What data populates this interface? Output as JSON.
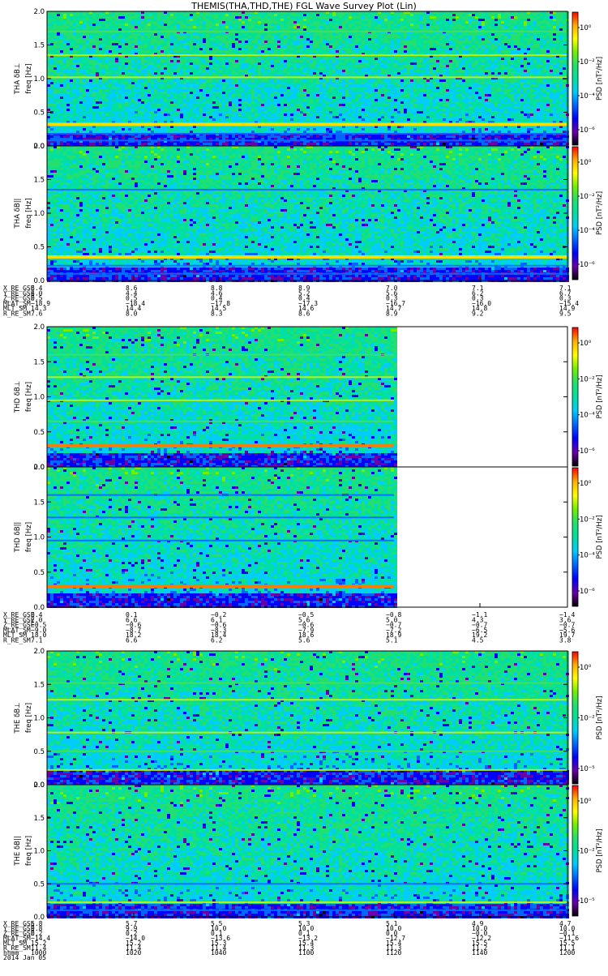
{
  "title": "THEMIS(THA,THD,THE) FGL Wave Survey Plot (Lin)",
  "colors": {
    "colorbar": [
      "#000000",
      "#6a00a8",
      "#0000ff",
      "#0066ff",
      "#00ccff",
      "#00e0a0",
      "#22e070",
      "#70f000",
      "#ffff00",
      "#ffb000",
      "#ff0000"
    ],
    "spectrogram_bg": "#2aa6e6"
  },
  "chart_data": [
    {
      "type": "heatmap",
      "label": "THA δB⊥",
      "ylabel": "freq [Hz]",
      "ylim": [
        0.0,
        2.0
      ],
      "yticks": [
        "0.0",
        "0.5",
        "1.0",
        "1.5",
        "2.0"
      ],
      "colorbar_label": "PSD [nT²/Hz]",
      "colorbar_ticks": [
        "10⁰",
        "10⁻²",
        "10⁻⁴",
        "10⁻⁶"
      ],
      "data_coverage_fraction": 1.0,
      "bands_hz": [
        0.08,
        0.18,
        0.32,
        1.02,
        1.35,
        1.7
      ],
      "band_strength": [
        0.3,
        0.2,
        1.0,
        0.7,
        0.8,
        0.4
      ]
    },
    {
      "type": "heatmap",
      "label": "THA δB||",
      "ylabel": "freq [Hz]",
      "ylim": [
        0.0,
        2.0
      ],
      "yticks": [
        "0.0",
        "0.5",
        "1.0",
        "1.5",
        "2.0"
      ],
      "colorbar_label": "PSD [nT²/Hz]",
      "colorbar_ticks": [
        "10⁰",
        "10⁻²",
        "10⁻⁴",
        "10⁻⁶"
      ],
      "data_coverage_fraction": 1.0,
      "bands_hz": [
        0.1,
        0.22,
        0.35,
        1.35
      ],
      "band_strength": [
        0.3,
        0.3,
        1.0,
        0.2
      ]
    },
    {
      "type": "heatmap",
      "label": "THD δB⊥",
      "ylabel": "freq [Hz]",
      "ylim": [
        0.0,
        2.0
      ],
      "yticks": [
        "0.0",
        "0.5",
        "1.0",
        "1.5",
        "2.0"
      ],
      "colorbar_label": "PSD [nT²/Hz]",
      "colorbar_ticks": [
        "10⁰",
        "10⁻²",
        "10⁻⁴",
        "10⁻⁶"
      ],
      "data_coverage_fraction": 0.6667,
      "bands_hz": [
        0.3,
        0.65,
        0.95,
        1.28,
        1.6
      ],
      "band_strength": [
        1.2,
        0.4,
        0.7,
        0.7,
        0.4
      ]
    },
    {
      "type": "heatmap",
      "label": "THD δB||",
      "ylabel": "freq [Hz]",
      "ylim": [
        0.0,
        2.0
      ],
      "yticks": [
        "0.0",
        "0.5",
        "1.0",
        "1.5",
        "2.0"
      ],
      "colorbar_label": "PSD [nT²/Hz]",
      "colorbar_ticks": [
        "10⁰",
        "10⁻²",
        "10⁻⁴",
        "10⁻⁶"
      ],
      "data_coverage_fraction": 0.6667,
      "bands_hz": [
        0.3,
        0.95,
        1.28,
        1.6
      ],
      "band_strength": [
        1.2,
        0.3,
        0.3,
        0.2
      ]
    },
    {
      "type": "heatmap",
      "label": "THE δB⊥",
      "ylabel": "freq [Hz]",
      "ylim": [
        0.0,
        2.0
      ],
      "yticks": [
        "0.0",
        "0.5",
        "1.0",
        "1.5",
        "2.0"
      ],
      "colorbar_label": "PSD [nT²/Hz]",
      "colorbar_ticks": [
        "10⁰",
        "10⁻²",
        "10⁻⁵"
      ],
      "data_coverage_fraction": 1.0,
      "bands_hz": [
        0.22,
        0.5,
        0.78,
        1.27,
        1.52
      ],
      "band_strength": [
        0.6,
        0.5,
        0.6,
        0.8,
        0.4
      ]
    },
    {
      "type": "heatmap",
      "label": "THE δB||",
      "ylabel": "freq [Hz]",
      "ylim": [
        0.0,
        2.0
      ],
      "yticks": [
        "0.0",
        "0.5",
        "1.0",
        "1.5",
        "2.0"
      ],
      "colorbar_label": "PSD [nT²/Hz]",
      "colorbar_ticks": [
        "10⁰",
        "10⁻²",
        "10⁻⁵"
      ],
      "data_coverage_fraction": 1.0,
      "bands_hz": [
        0.1,
        0.22,
        0.5
      ],
      "band_strength": [
        0.2,
        0.6,
        0.2
      ]
    }
  ],
  "ephemeris": [
    {
      "rows": [
        {
          "label": "X_RE_GSE",
          "values": [
            "8.4",
            "8.6",
            "8.8",
            "8.9",
            "7.0",
            "7.1",
            "7.1"
          ]
        },
        {
          "label": "Y_RE_GSE",
          "values": [
            "4.0",
            "4.4",
            "4.6",
            "5.2",
            "5.6",
            "6.2",
            "6.7"
          ]
        },
        {
          "label": "Z_RE_GSE",
          "values": [
            "0.5",
            "0.5",
            "0.4",
            "0.4",
            "0.3",
            "0.3",
            "0.3"
          ]
        },
        {
          "label": "MLAT_SM",
          "values": [
            "−18.9",
            "−18.4",
            "−17.8",
            "−17.3",
            "−16.7",
            "−16.0",
            "−15.4"
          ]
        },
        {
          "label": "MLT_SM",
          "values": [
            "14.3",
            "14.4",
            "14.5",
            "14.6",
            "14.7",
            "14.8",
            "14.9"
          ]
        },
        {
          "label": "R_RE_SM",
          "values": [
            "7.6",
            "8.0",
            "8.3",
            "8.6",
            "8.9",
            "9.2",
            "9.5"
          ]
        }
      ]
    },
    {
      "rows": [
        {
          "label": "X_RE_GSE",
          "values": [
            "0.4",
            "0.1",
            "−0.2",
            "−0.5",
            "−0.8",
            "−1.1",
            "−1.4"
          ]
        },
        {
          "label": "Y_RE_GSE",
          "values": [
            "7.0",
            "6.6",
            "6.1",
            "5.6",
            "5.0",
            "4.3",
            "3.6"
          ]
        },
        {
          "label": "Z_RE_GSE",
          "values": [
            "−0.5",
            "−0.6",
            "−0.6",
            "−0.6",
            "−0.7",
            "−0.7",
            "−0.7"
          ]
        },
        {
          "label": "MLAT_SM",
          "values": [
            "−9.0",
            "−8.7",
            "−8.3",
            "−7.9",
            "−7.2",
            "−6.5",
            "−5.6"
          ]
        },
        {
          "label": "MLT_SM",
          "values": [
            "18.0",
            "18.2",
            "18.4",
            "18.6",
            "18.9",
            "19.2",
            "19.7"
          ]
        },
        {
          "label": "R_RE_SM",
          "values": [
            "7.1",
            "6.6",
            "6.2",
            "5.6",
            "5.1",
            "4.5",
            "3.8"
          ]
        }
      ]
    },
    {
      "rows": [
        {
          "label": "X_RE_GSE",
          "values": [
            "5.8",
            "5.7",
            "5.5",
            "5.3",
            "5.1",
            "4.9",
            "4.7"
          ]
        },
        {
          "label": "Y_RE_GSE",
          "values": [
            "9.8",
            "9.9",
            "10.0",
            "10.0",
            "10.0",
            "10.0",
            "10.0"
          ]
        },
        {
          "label": "Z_RE_GSE",
          "values": [
            "0.2",
            "0.2",
            "0.1",
            "0.1",
            "0.0",
            "−0.0",
            "−0.1"
          ]
        },
        {
          "label": "MLAT_SM",
          "values": [
            "−14.4",
            "−14.0",
            "−13.6",
            "−13.2",
            "−12.7",
            "−12.2",
            "−11.6"
          ]
        },
        {
          "label": "MLT_SM",
          "values": [
            "15.2",
            "15.2",
            "15.3",
            "15.4",
            "15.4",
            "15.5",
            "15.5"
          ]
        },
        {
          "label": "R_RE_SM",
          "values": [
            "11.4",
            "11.4",
            "11.4",
            "11.3",
            "11.3",
            "11.2",
            "11.1"
          ]
        },
        {
          "label": "hhmm",
          "values": [
            "1000",
            "1020",
            "1040",
            "1100",
            "1120",
            "1140",
            "1200"
          ]
        }
      ],
      "date": "2014 Jan 05"
    }
  ]
}
